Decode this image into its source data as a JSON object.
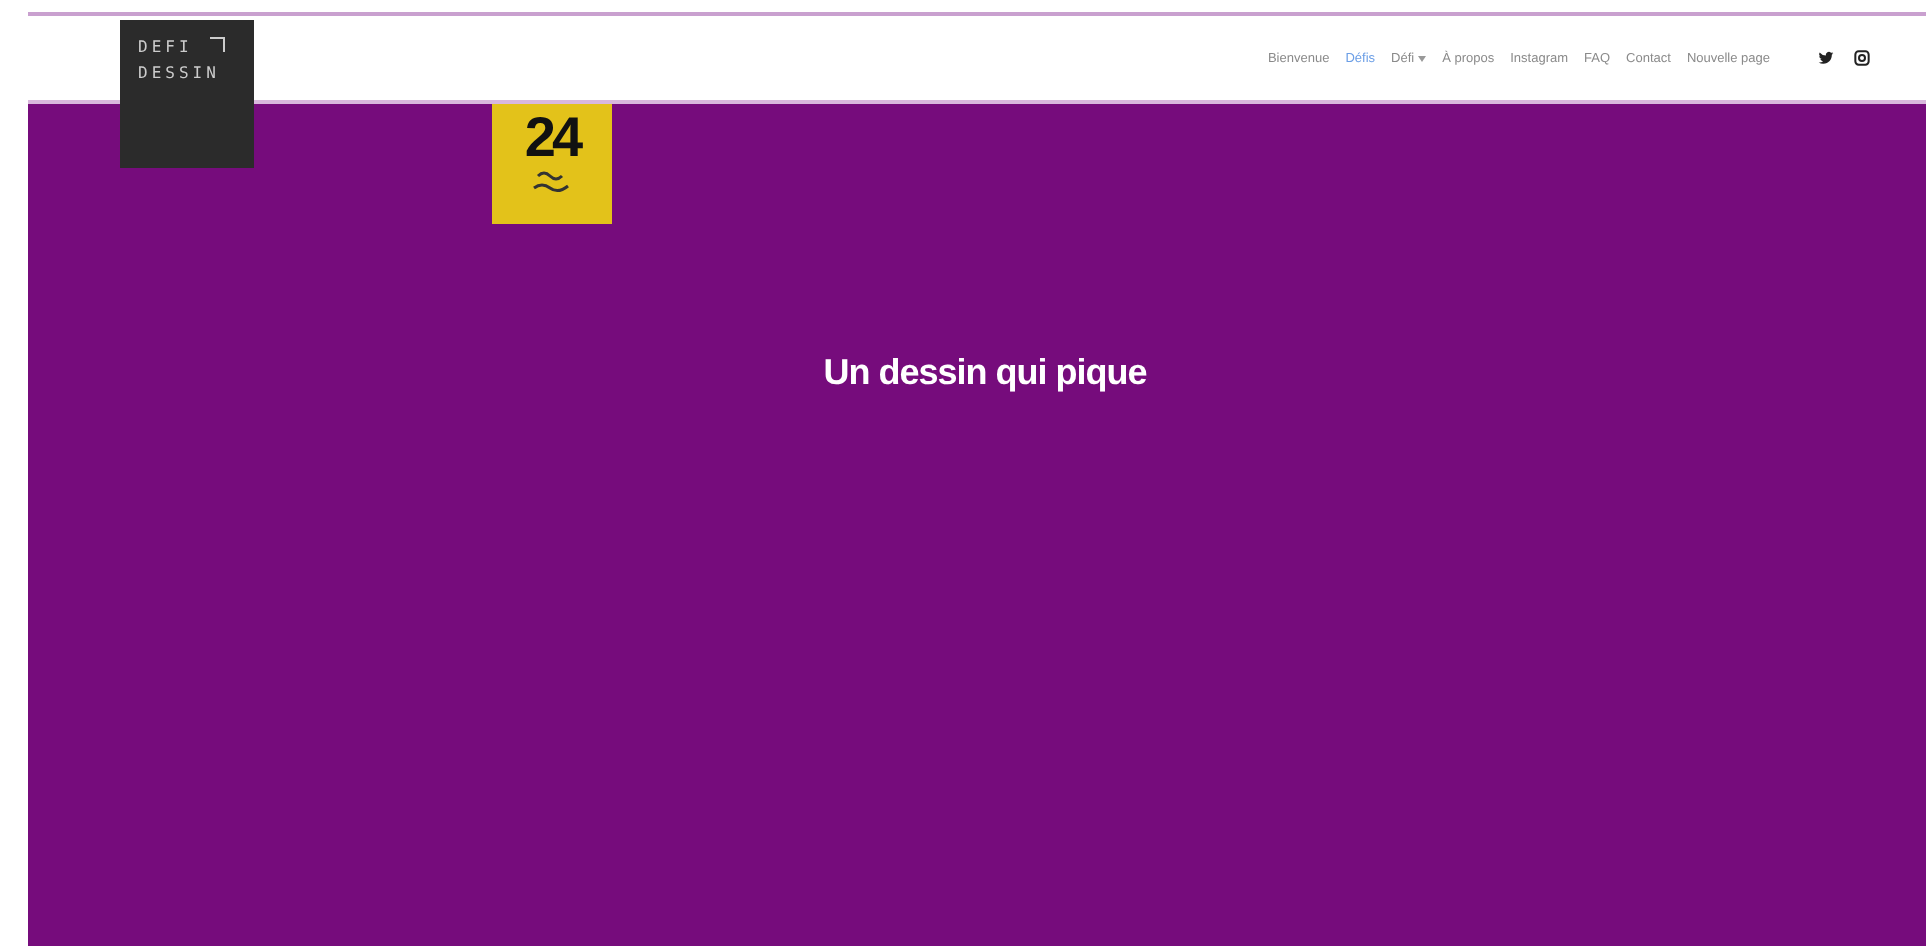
{
  "logo": {
    "lines": [
      "DEFI",
      "DESSIN"
    ]
  },
  "nav": [
    {
      "label": "Bienvenue",
      "selected": false,
      "dropdown": false
    },
    {
      "label": "Défis",
      "selected": true,
      "dropdown": false
    },
    {
      "label": "Défi",
      "selected": false,
      "dropdown": true
    },
    {
      "label": "À propos",
      "selected": false,
      "dropdown": false
    },
    {
      "label": "Instagram",
      "selected": false,
      "dropdown": false
    },
    {
      "label": "FAQ",
      "selected": false,
      "dropdown": false
    },
    {
      "label": "Contact",
      "selected": false,
      "dropdown": false
    },
    {
      "label": "Nouvelle page",
      "selected": false,
      "dropdown": false
    }
  ],
  "social": [
    {
      "kind": "twitter"
    },
    {
      "kind": "instagram"
    }
  ],
  "badge": {
    "number": "24"
  },
  "hero": {
    "title": "Un dessin qui pique"
  }
}
